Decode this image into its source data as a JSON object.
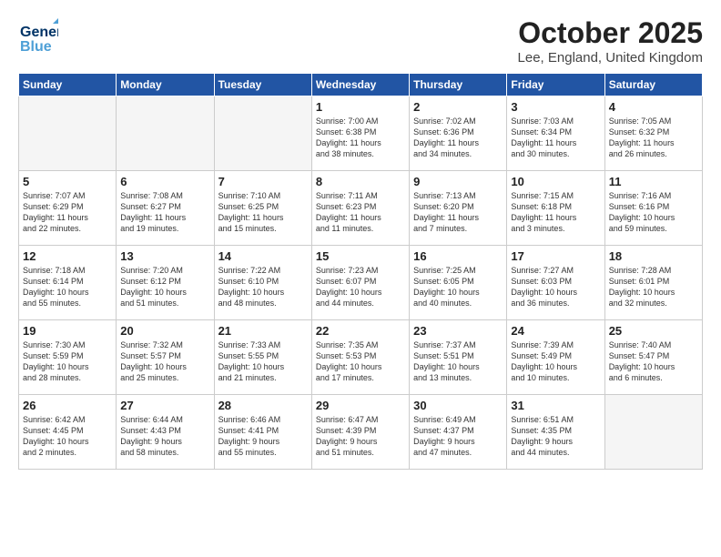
{
  "header": {
    "logo_general": "General",
    "logo_blue": "Blue",
    "month": "October 2025",
    "location": "Lee, England, United Kingdom"
  },
  "weekdays": [
    "Sunday",
    "Monday",
    "Tuesday",
    "Wednesday",
    "Thursday",
    "Friday",
    "Saturday"
  ],
  "weeks": [
    [
      {
        "day": "",
        "info": ""
      },
      {
        "day": "",
        "info": ""
      },
      {
        "day": "",
        "info": ""
      },
      {
        "day": "1",
        "info": "Sunrise: 7:00 AM\nSunset: 6:38 PM\nDaylight: 11 hours\nand 38 minutes."
      },
      {
        "day": "2",
        "info": "Sunrise: 7:02 AM\nSunset: 6:36 PM\nDaylight: 11 hours\nand 34 minutes."
      },
      {
        "day": "3",
        "info": "Sunrise: 7:03 AM\nSunset: 6:34 PM\nDaylight: 11 hours\nand 30 minutes."
      },
      {
        "day": "4",
        "info": "Sunrise: 7:05 AM\nSunset: 6:32 PM\nDaylight: 11 hours\nand 26 minutes."
      }
    ],
    [
      {
        "day": "5",
        "info": "Sunrise: 7:07 AM\nSunset: 6:29 PM\nDaylight: 11 hours\nand 22 minutes."
      },
      {
        "day": "6",
        "info": "Sunrise: 7:08 AM\nSunset: 6:27 PM\nDaylight: 11 hours\nand 19 minutes."
      },
      {
        "day": "7",
        "info": "Sunrise: 7:10 AM\nSunset: 6:25 PM\nDaylight: 11 hours\nand 15 minutes."
      },
      {
        "day": "8",
        "info": "Sunrise: 7:11 AM\nSunset: 6:23 PM\nDaylight: 11 hours\nand 11 minutes."
      },
      {
        "day": "9",
        "info": "Sunrise: 7:13 AM\nSunset: 6:20 PM\nDaylight: 11 hours\nand 7 minutes."
      },
      {
        "day": "10",
        "info": "Sunrise: 7:15 AM\nSunset: 6:18 PM\nDaylight: 11 hours\nand 3 minutes."
      },
      {
        "day": "11",
        "info": "Sunrise: 7:16 AM\nSunset: 6:16 PM\nDaylight: 10 hours\nand 59 minutes."
      }
    ],
    [
      {
        "day": "12",
        "info": "Sunrise: 7:18 AM\nSunset: 6:14 PM\nDaylight: 10 hours\nand 55 minutes."
      },
      {
        "day": "13",
        "info": "Sunrise: 7:20 AM\nSunset: 6:12 PM\nDaylight: 10 hours\nand 51 minutes."
      },
      {
        "day": "14",
        "info": "Sunrise: 7:22 AM\nSunset: 6:10 PM\nDaylight: 10 hours\nand 48 minutes."
      },
      {
        "day": "15",
        "info": "Sunrise: 7:23 AM\nSunset: 6:07 PM\nDaylight: 10 hours\nand 44 minutes."
      },
      {
        "day": "16",
        "info": "Sunrise: 7:25 AM\nSunset: 6:05 PM\nDaylight: 10 hours\nand 40 minutes."
      },
      {
        "day": "17",
        "info": "Sunrise: 7:27 AM\nSunset: 6:03 PM\nDaylight: 10 hours\nand 36 minutes."
      },
      {
        "day": "18",
        "info": "Sunrise: 7:28 AM\nSunset: 6:01 PM\nDaylight: 10 hours\nand 32 minutes."
      }
    ],
    [
      {
        "day": "19",
        "info": "Sunrise: 7:30 AM\nSunset: 5:59 PM\nDaylight: 10 hours\nand 28 minutes."
      },
      {
        "day": "20",
        "info": "Sunrise: 7:32 AM\nSunset: 5:57 PM\nDaylight: 10 hours\nand 25 minutes."
      },
      {
        "day": "21",
        "info": "Sunrise: 7:33 AM\nSunset: 5:55 PM\nDaylight: 10 hours\nand 21 minutes."
      },
      {
        "day": "22",
        "info": "Sunrise: 7:35 AM\nSunset: 5:53 PM\nDaylight: 10 hours\nand 17 minutes."
      },
      {
        "day": "23",
        "info": "Sunrise: 7:37 AM\nSunset: 5:51 PM\nDaylight: 10 hours\nand 13 minutes."
      },
      {
        "day": "24",
        "info": "Sunrise: 7:39 AM\nSunset: 5:49 PM\nDaylight: 10 hours\nand 10 minutes."
      },
      {
        "day": "25",
        "info": "Sunrise: 7:40 AM\nSunset: 5:47 PM\nDaylight: 10 hours\nand 6 minutes."
      }
    ],
    [
      {
        "day": "26",
        "info": "Sunrise: 6:42 AM\nSunset: 4:45 PM\nDaylight: 10 hours\nand 2 minutes."
      },
      {
        "day": "27",
        "info": "Sunrise: 6:44 AM\nSunset: 4:43 PM\nDaylight: 9 hours\nand 58 minutes."
      },
      {
        "day": "28",
        "info": "Sunrise: 6:46 AM\nSunset: 4:41 PM\nDaylight: 9 hours\nand 55 minutes."
      },
      {
        "day": "29",
        "info": "Sunrise: 6:47 AM\nSunset: 4:39 PM\nDaylight: 9 hours\nand 51 minutes."
      },
      {
        "day": "30",
        "info": "Sunrise: 6:49 AM\nSunset: 4:37 PM\nDaylight: 9 hours\nand 47 minutes."
      },
      {
        "day": "31",
        "info": "Sunrise: 6:51 AM\nSunset: 4:35 PM\nDaylight: 9 hours\nand 44 minutes."
      },
      {
        "day": "",
        "info": ""
      }
    ]
  ]
}
